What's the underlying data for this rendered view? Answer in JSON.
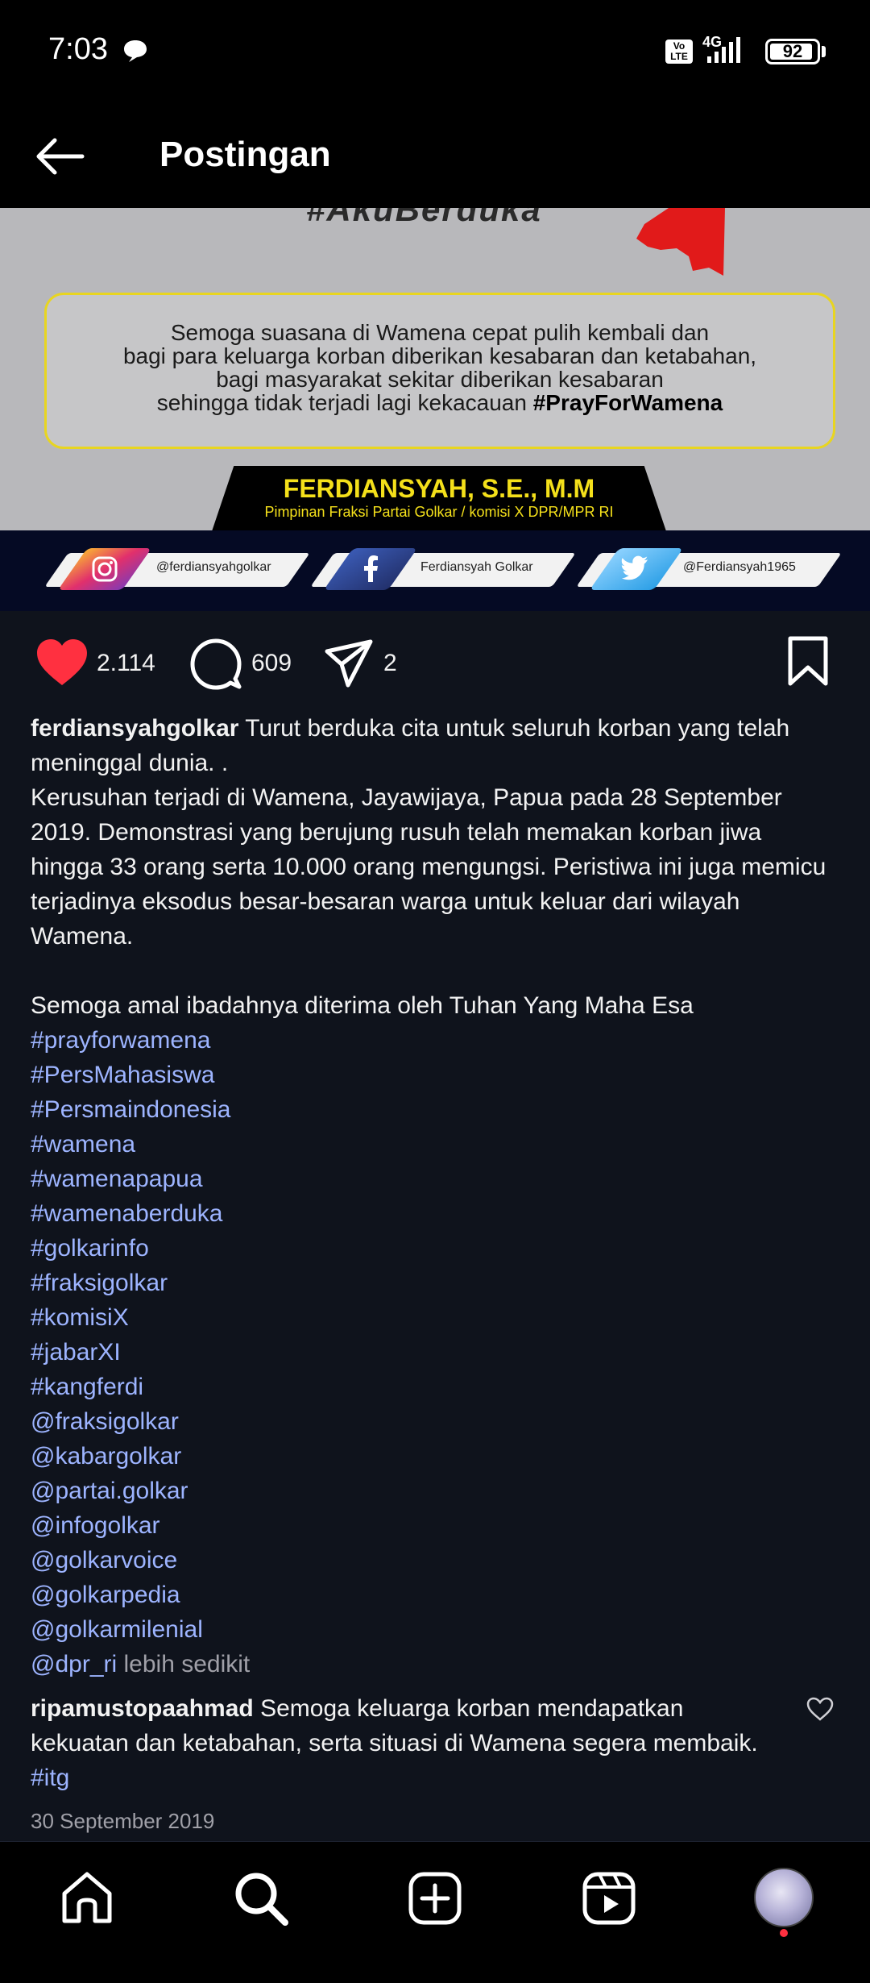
{
  "status_bar": {
    "time": "7:03",
    "lte_badge": "Vo LTE",
    "network": "4G",
    "battery": "92",
    "battery_level": 0.92
  },
  "header": {
    "title": "Postingan"
  },
  "post_image": {
    "top_text": "#AkuBerduka",
    "quote_lines": [
      "Semoga suasana di Wamena cepat pulih kembali dan",
      "bagi para keluarga korban diberikan kesabaran dan ketabahan,",
      "bagi masyarakat sekitar diberikan kesabaran",
      "sehingga tidak terjadi lagi kekacauan"
    ],
    "quote_hashtag": "#PrayForWamena",
    "banner_name": "FERDIANSYAH, S.E., M.M",
    "banner_subtitle": "Pimpinan Fraksi Partai Golkar / komisi X DPR/MPR RI",
    "social": {
      "instagram": "@ferdiansyahgolkar",
      "facebook": "Ferdiansyah Golkar",
      "twitter": "@Ferdiansyah1965"
    }
  },
  "actions": {
    "likes": "2.114",
    "comments": "609",
    "shares": "2"
  },
  "caption": {
    "username": "ferdiansyahgolkar",
    "text_1": "Turut berduka cita untuk seluruh korban yang telah meninggal dunia. .",
    "text_2": "Kerusuhan terjadi di Wamena, Jayawijaya, Papua pada 28 September 2019. Demonstrasi yang berujung rusuh telah memakan korban jiwa hingga 33 orang serta 10.000 orang mengungsi. Peristiwa ini juga memicu terjadinya eksodus besar-besaran warga untuk keluar dari wilayah Wamena.",
    "text_3": "Semoga amal ibadahnya diterima oleh Tuhan Yang Maha Esa",
    "tags": [
      "#prayforwamena",
      "#PersMahasiswa",
      "#Persmaindonesia",
      "#wamena",
      "#wamenapapua",
      "#wamenaberduka",
      "#golkarinfo",
      "#fraksigolkar",
      "#komisiX",
      "#jabarXI",
      "#kangferdi",
      "@fraksigolkar",
      "@kabargolkar",
      "@partai.golkar",
      "@infogolkar",
      "@golkarvoice",
      "@golkarpedia",
      "@golkarmilenial"
    ],
    "last_tag": "@dpr_ri",
    "more_label": "lebih sedikit"
  },
  "comment": {
    "username": "ripamustopaahmad",
    "text": "Semoga keluarga korban mendapatkan kekuatan dan ketabahan, serta situasi di Wamena segera membaik.",
    "tag": "#itg"
  },
  "post_date": "30 September 2019",
  "colors": {
    "background": "#0f131c",
    "link": "#9db4ff",
    "like_red": "#ff3040",
    "banner_yellow": "#f4e01a"
  },
  "icons": [
    "chat-icon",
    "signal-icon",
    "battery-icon",
    "back-arrow-icon",
    "heart-icon",
    "comment-icon",
    "share-icon",
    "bookmark-icon",
    "home-icon",
    "search-icon",
    "create-icon",
    "reels-icon"
  ]
}
